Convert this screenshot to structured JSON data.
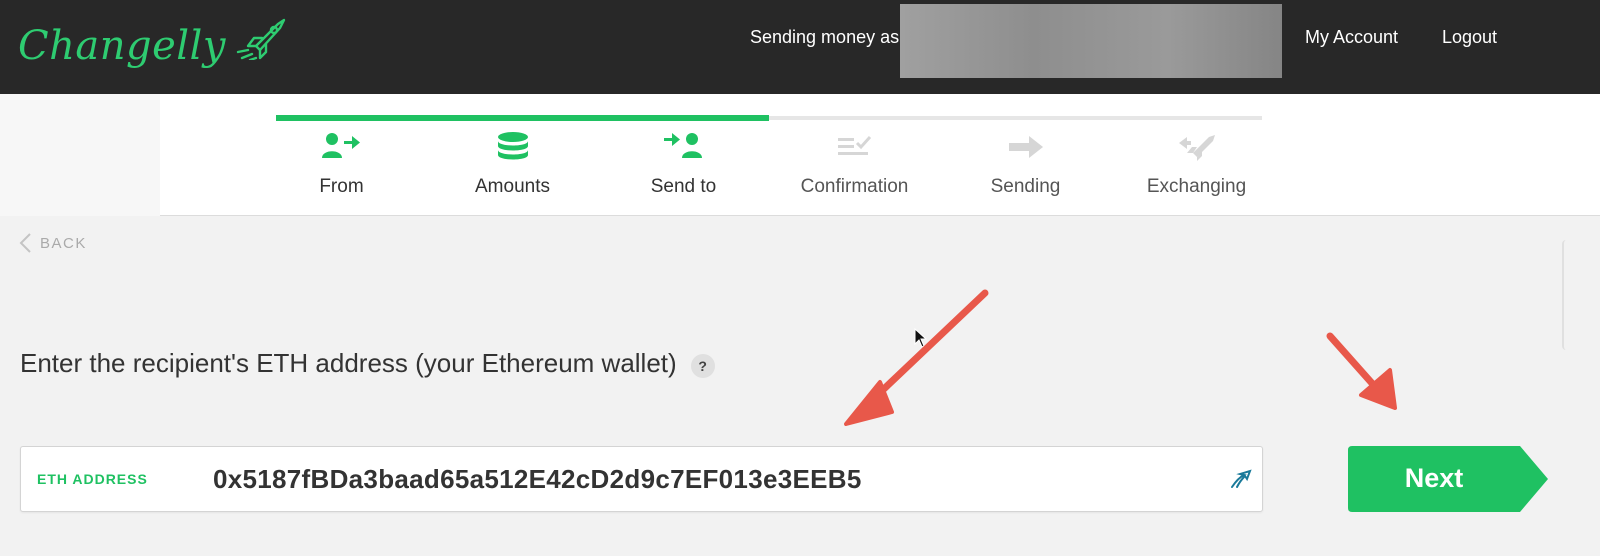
{
  "header": {
    "logo_text": "Changelly",
    "sending_as": "Sending money as",
    "my_account": "My Account",
    "logout": "Logout"
  },
  "steps": [
    {
      "label": "From",
      "icon": "user-arrow-icon",
      "state": "done"
    },
    {
      "label": "Amounts",
      "icon": "coin-stack-icon",
      "state": "done"
    },
    {
      "label": "Send to",
      "icon": "arrow-user-icon",
      "state": "current"
    },
    {
      "label": "Confirmation",
      "icon": "list-check-icon",
      "state": "todo"
    },
    {
      "label": "Sending",
      "icon": "arrow-right-icon",
      "state": "todo"
    },
    {
      "label": "Exchanging",
      "icon": "exchange-rocket-icon",
      "state": "todo"
    }
  ],
  "progress": {
    "completed_steps": 3,
    "total_steps": 6
  },
  "back_label": "BACK",
  "prompt": "Enter the recipient's ETH address (your Ethereum wallet)",
  "help_symbol": "?",
  "address": {
    "label": "ETH ADDRESS",
    "value": "0x5187fBDa3baad65a512E42cD2d9c7EF013e3EEB5"
  },
  "next_label": "Next",
  "colors": {
    "brand_green": "#1fc162",
    "header_bg": "#282828",
    "annotation_arrow": "#e8584a"
  }
}
